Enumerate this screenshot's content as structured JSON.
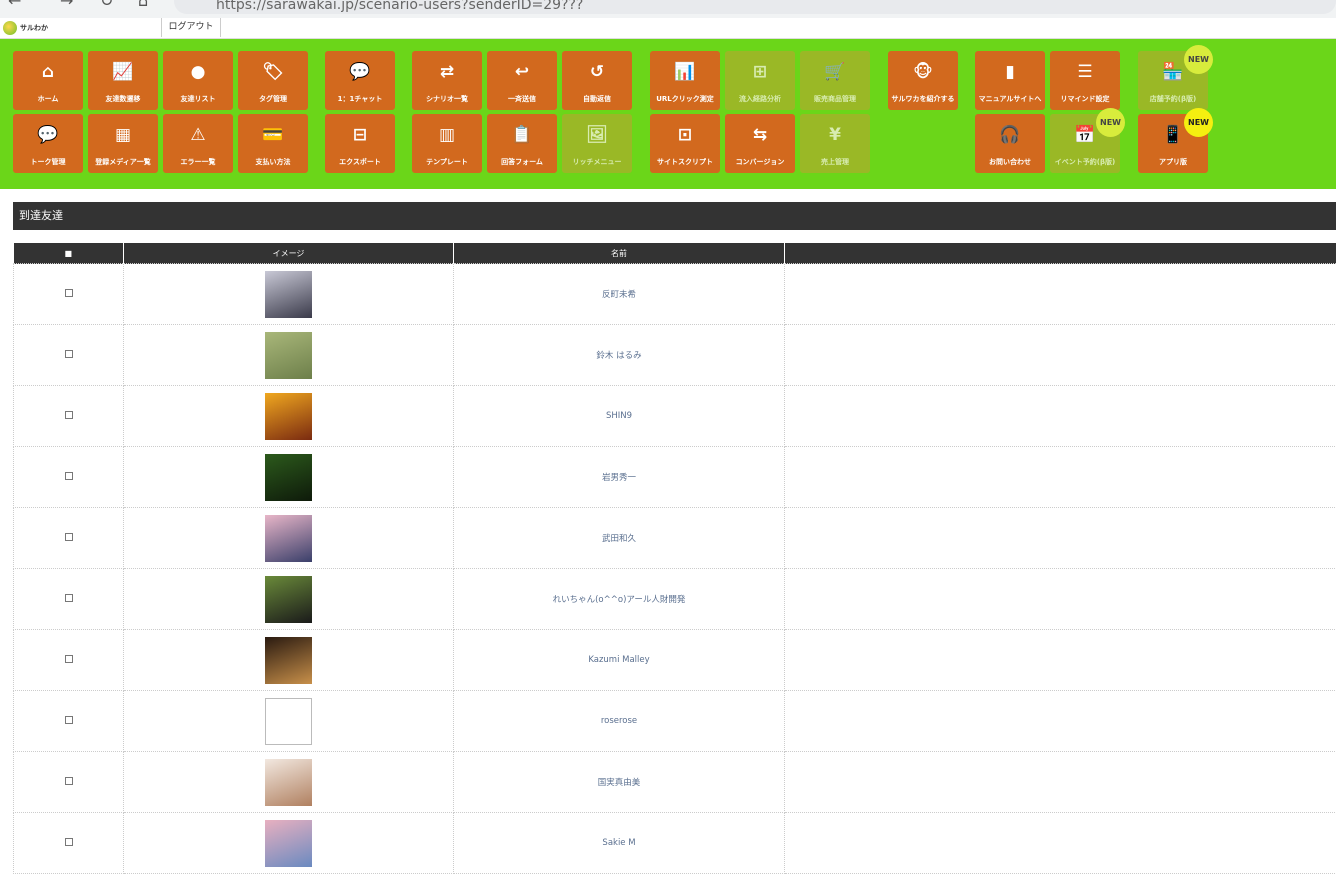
{
  "browser": {
    "back_icon": "arrow-left-icon",
    "forward_icon": "arrow-right-icon",
    "reload_icon": "reload-icon",
    "url": "https://sarawakai.jp/scenario-users?senderID=29???"
  },
  "topbar": {
    "logo_text": "サルわか",
    "logout_label": "ログアウト"
  },
  "menu": {
    "row1": [
      {
        "label": "ホーム",
        "icon": "home-icon",
        "glyph": "⌂",
        "dim": false
      },
      {
        "label": "友達数遷移",
        "icon": "line-chart-icon",
        "glyph": "📈",
        "dim": false
      },
      {
        "label": "友達リスト",
        "icon": "user-icon",
        "glyph": "●",
        "dim": false
      },
      {
        "label": "タグ管理",
        "icon": "tag-icon",
        "glyph": "🏷",
        "dim": false
      },
      {
        "label": "1：1チャット",
        "icon": "chat-bubble-icon",
        "glyph": "💬",
        "dim": false
      },
      {
        "label": "シナリオ一覧",
        "icon": "shuffle-icon",
        "glyph": "⇄",
        "dim": false
      },
      {
        "label": "一斉送信",
        "icon": "reply-icon",
        "glyph": "↩",
        "dim": false
      },
      {
        "label": "自動返信",
        "icon": "return-icon",
        "glyph": "↺",
        "dim": false
      },
      {
        "label": "URLクリック測定",
        "icon": "bar-chart-icon",
        "glyph": "📊",
        "dim": false
      },
      {
        "label": "流入経路分析",
        "icon": "sitemap-icon",
        "glyph": "⊞",
        "dim": true
      },
      {
        "label": "販売商品管理",
        "icon": "cart-icon",
        "glyph": "🛒",
        "dim": true
      },
      {
        "label": "サルワカを紹介する",
        "icon": "monkey-icon",
        "glyph": "🐵",
        "dim": false
      },
      {
        "label": "マニュアルサイトへ",
        "icon": "book-icon",
        "glyph": "▮",
        "dim": false
      },
      {
        "label": "リマインド設定",
        "icon": "list-icon",
        "glyph": "☰",
        "dim": false
      },
      {
        "label": "店舗予約(β版)",
        "icon": "store-icon",
        "glyph": "🏪",
        "dim": true
      }
    ],
    "row2": [
      {
        "label": "トーク管理",
        "icon": "speech-icon",
        "glyph": "💬",
        "dim": false
      },
      {
        "label": "登録メディア一覧",
        "icon": "map-icon",
        "glyph": "▦",
        "dim": false
      },
      {
        "label": "エラー一覧",
        "icon": "warning-icon",
        "glyph": "⚠",
        "dim": false
      },
      {
        "label": "支払い方法",
        "icon": "card-icon",
        "glyph": "💳",
        "dim": false
      },
      {
        "label": "エクスポート",
        "icon": "drive-icon",
        "glyph": "⊟",
        "dim": false
      },
      {
        "label": "テンプレート",
        "icon": "template-icon",
        "glyph": "▥",
        "dim": false
      },
      {
        "label": "回答フォーム",
        "icon": "form-icon",
        "glyph": "📋",
        "dim": false
      },
      {
        "label": "リッチメニュー",
        "icon": "image-icon",
        "glyph": "🖼",
        "dim": true
      },
      {
        "label": "サイトスクリプト",
        "icon": "browser-icon",
        "glyph": "⊡",
        "dim": false
      },
      {
        "label": "コンバージョン",
        "icon": "exchange-icon",
        "glyph": "⇆",
        "dim": false
      },
      {
        "label": "売上管理",
        "icon": "yen-icon",
        "glyph": "¥",
        "dim": true
      },
      {
        "label": "お問い合わせ",
        "icon": "headset-icon",
        "glyph": "🎧",
        "dim": false
      },
      {
        "label": "イベント予約(β版)",
        "icon": "calendar-icon",
        "glyph": "📅",
        "dim": true
      },
      {
        "label": "アプリ版",
        "icon": "mobile-icon",
        "glyph": "📱",
        "dim": false
      }
    ],
    "badges": [
      "NEW",
      "NEW",
      "NEW"
    ]
  },
  "section": {
    "title": "到達友達"
  },
  "table": {
    "headers": [
      "■",
      "イメージ",
      "名前",
      ""
    ],
    "rows": [
      {
        "name": "反町未希",
        "avatar": "person-photo-1",
        "colors": [
          "#c9c9d6",
          "#3a3a4a"
        ]
      },
      {
        "name": "鈴木 はるみ",
        "avatar": "outdoor-photo",
        "colors": [
          "#a9b77a",
          "#6d7f4a"
        ]
      },
      {
        "name": "SHIN9",
        "avatar": "lion-photo",
        "colors": [
          "#f0a820",
          "#7a2a10"
        ]
      },
      {
        "name": "岩男秀一",
        "avatar": "man-poster-photo",
        "colors": [
          "#2c5a1c",
          "#0e1a0a"
        ]
      },
      {
        "name": "武田和久",
        "avatar": "sakura-man-photo",
        "colors": [
          "#e8b6c8",
          "#3a3f6a"
        ]
      },
      {
        "name": "れいちゃん(o^^o)アール人財開発",
        "avatar": "woman-photo",
        "colors": [
          "#6a8a3a",
          "#1a1a1a"
        ]
      },
      {
        "name": "Kazumi Malley",
        "avatar": "dark-portrait-photo",
        "colors": [
          "#2a1a10",
          "#c8904a"
        ]
      },
      {
        "name": "roserose",
        "avatar": "broken-image",
        "colors": [
          "#ffffff",
          "#ffffff"
        ]
      },
      {
        "name": "国実真由美",
        "avatar": "smiling-woman-photo",
        "colors": [
          "#f2e8e0",
          "#b08060"
        ]
      },
      {
        "name": "Sakie M",
        "avatar": "cherry-blossom-photo",
        "colors": [
          "#e8b0c0",
          "#6a8ac0"
        ]
      }
    ]
  }
}
